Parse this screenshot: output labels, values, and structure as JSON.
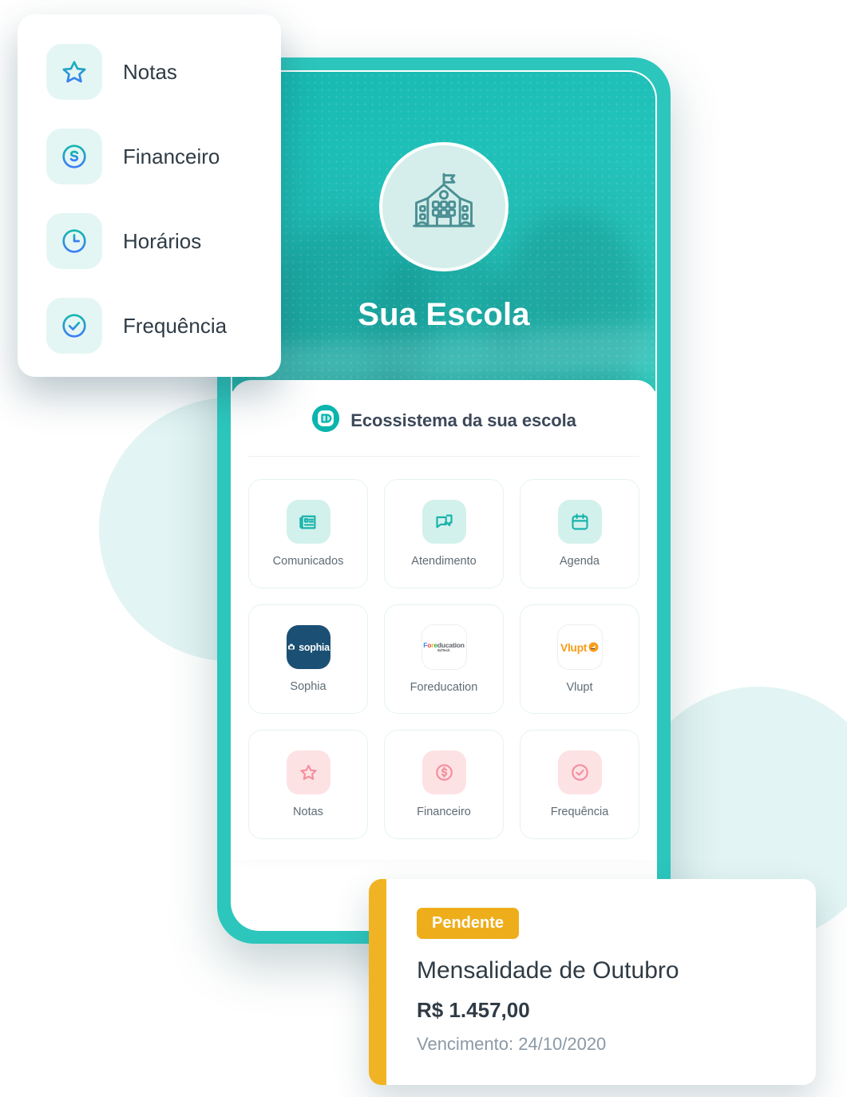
{
  "colors": {
    "teal": "#22c3bb",
    "teal_dark": "#16b8b0",
    "mint": "#d3f1ec",
    "blob": "#e2f4f3",
    "pink": "#fde2e4",
    "pink_icon": "#f58d9d",
    "navy": "#1b5074",
    "amber": "#eead1b",
    "amber_accent": "#f0b323",
    "text_dark": "#2f3b45",
    "text_muted": "#8b99a5",
    "orange": "#f99d1c"
  },
  "menu_card": {
    "items": [
      {
        "label": "Notas",
        "icon": "star-icon"
      },
      {
        "label": "Financeiro",
        "icon": "dollar-circle-icon"
      },
      {
        "label": "Horários",
        "icon": "clock-icon"
      },
      {
        "label": "Frequência",
        "icon": "check-circle-icon"
      }
    ]
  },
  "phone": {
    "hero": {
      "school_name": "Sua Escola",
      "logo_icon": "school-building-icon"
    },
    "ecosystem": {
      "title": "Ecossistema da sua escola",
      "logo_icon": "ecosystem-leaf-icon",
      "tiles": [
        {
          "label": "Comunicados",
          "icon": "newspaper-icon",
          "style": "icon-teal"
        },
        {
          "label": "Atendimento",
          "icon": "chat-bubbles-icon",
          "style": "icon-teal"
        },
        {
          "label": "Agenda",
          "icon": "calendar-icon",
          "style": "icon-teal"
        },
        {
          "label": "Sophia",
          "icon": "sophia-logo",
          "style": "icon-navy"
        },
        {
          "label": "Foreducation",
          "icon": "foreducation-logo",
          "style": "icon-plain"
        },
        {
          "label": "Vlupt",
          "icon": "vlupt-logo",
          "style": "icon-plain"
        },
        {
          "label": "Notas",
          "icon": "star-icon",
          "style": "icon-pink"
        },
        {
          "label": "Financeiro",
          "icon": "dollar-circle-icon",
          "style": "icon-pink"
        },
        {
          "label": "Frequência",
          "icon": "check-circle-icon",
          "style": "icon-pink"
        }
      ]
    }
  },
  "brands": {
    "sophia": "sophia",
    "foreducation": {
      "f": "F",
      "o": "o",
      "r": "r",
      "e": "e",
      "rest": "ducation",
      "sub": "EdTech"
    },
    "vlupt": "Vlupt"
  },
  "payment_card": {
    "status": "Pendente",
    "title": "Mensalidade de Outubro",
    "amount": "R$ 1.457,00",
    "due": "Vencimento: 24/10/2020"
  }
}
